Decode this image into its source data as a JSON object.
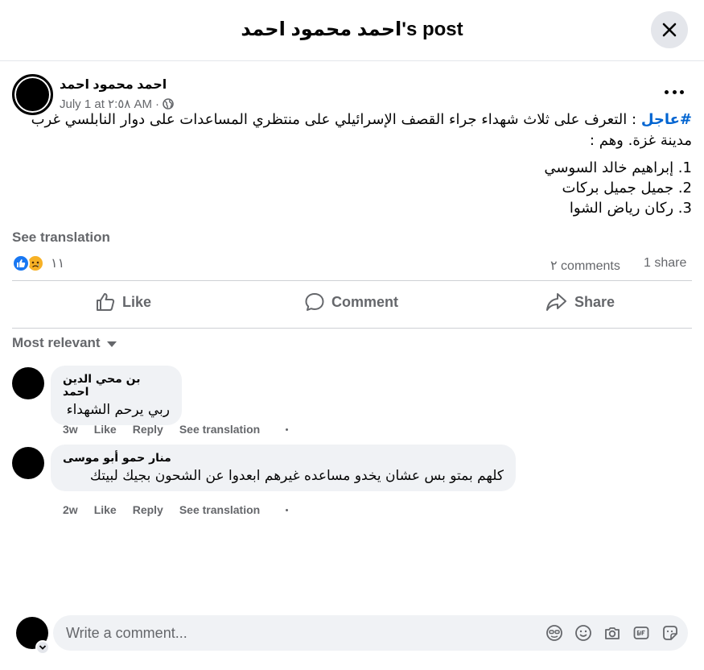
{
  "header": {
    "title": "احمد محمود احمد's post",
    "close_icon": "close-icon"
  },
  "post": {
    "author": "احمد محمود احمد",
    "timestamp": "July 1 at ٢:٥٨ AM",
    "separator": "·",
    "privacy_icon": "globe-icon",
    "hashtag": "#عاجل",
    "body": ": التعرف على ثلاث شهداء جراء القصف الإسرائيلي على منتظري المساعدات على دوار النابلسي غرب مدينة غزة. وهم :",
    "list": [
      "1. إبراهيم خالد السوسي",
      "2. جميل جميل بركات",
      "3. ركان رياض الشوا"
    ],
    "see_translation": "See translation",
    "reaction_count": "١١",
    "comment_count": "٢ comments",
    "share_count": "1 share",
    "reaction_icons": [
      "like-reaction-icon",
      "sad-reaction-icon"
    ]
  },
  "actions": {
    "like": "Like",
    "comment": "Comment",
    "share": "Share"
  },
  "sort_label": "Most relevant",
  "comments": [
    {
      "author": "بن محي الدين احمد",
      "text": "ربي يرحم الشهداء",
      "time": "3w",
      "like": "Like",
      "reply": "Reply",
      "translate": "See translation"
    },
    {
      "author": "منار حمو أبو موسى",
      "text": "كلهم بمتو بس عشان يخدو مساعده غيرهم ابعدوا عن الشحون بجيك لبيتك",
      "time": "2w",
      "like": "Like",
      "reply": "Reply",
      "translate": "See translation"
    }
  ],
  "composer": {
    "placeholder": "Write a comment...",
    "icons": [
      "avatar-sticker-icon",
      "emoji-icon",
      "camera-icon",
      "gif-icon",
      "sticker-icon"
    ]
  },
  "colors": {
    "accent": "#1877f2",
    "hashtag": "#0064d1",
    "secondary_text": "#65676b",
    "bubble": "#f0f2f5"
  }
}
